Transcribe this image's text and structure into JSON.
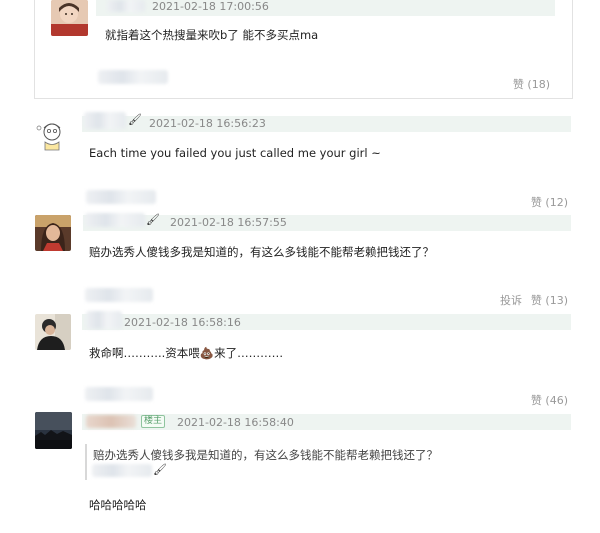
{
  "comments": [
    {
      "timestamp": "2021-02-18 17:00:56",
      "text": "就指着这个热搜量来吹b了 能不多买点ma",
      "likes": "赞 (18)"
    },
    {
      "timestamp": "2021-02-18 16:56:23",
      "text": "Each time you failed you just called me your girl ~",
      "likes": "赞 (12)"
    },
    {
      "timestamp": "2021-02-18 16:57:55",
      "text": "赔办选秀人傻钱多我是知道的，有这么多钱能不能帮老赖把钱还了？",
      "report": "投诉",
      "likes": "赞 (13)"
    },
    {
      "timestamp": "2021-02-18 16:58:16",
      "text": "救命啊………..资本喂💩来了…………",
      "likes": "赞 (46)"
    },
    {
      "timestamp": "2021-02-18 16:58:40",
      "badge": "楼主",
      "quote": "赔办选秀人傻钱多我是知道的，有这么多钱能不能帮老赖把钱还了？",
      "text": "哈哈哈哈哈"
    }
  ],
  "icons": {
    "brush_emoji": "🖌"
  },
  "colors": {
    "header_bar": "#eef4f1",
    "timestamp": "#888888",
    "badge_green": "#5aa06e"
  }
}
